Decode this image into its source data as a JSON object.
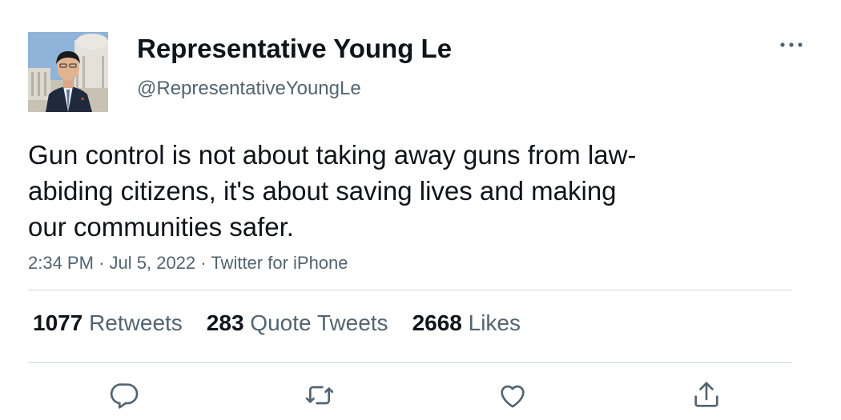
{
  "author": {
    "display_name": "Representative Young Le",
    "handle": "@RepresentativeYoungLe"
  },
  "tweet": {
    "text_lines": [
      "Gun control is not about taking away guns from law-",
      "abiding citizens, it's about saving lives and making",
      "our communities safer."
    ],
    "time": "2:34 PM",
    "date": "Jul 5, 2022",
    "source": "Twitter for iPhone",
    "separator": "·"
  },
  "stats": {
    "retweets": {
      "count": "1077",
      "label": "Retweets"
    },
    "quote_tweets": {
      "count": "283",
      "label": "Quote Tweets"
    },
    "likes": {
      "count": "2668",
      "label": "Likes"
    }
  },
  "icons": {
    "more": "more-horizontal-icon",
    "reply": "reply-icon",
    "retweet": "retweet-icon",
    "like": "heart-icon",
    "share": "share-icon"
  },
  "colors": {
    "text_primary": "#0f1419",
    "text_secondary": "#536471",
    "divider": "#cfd9de"
  }
}
